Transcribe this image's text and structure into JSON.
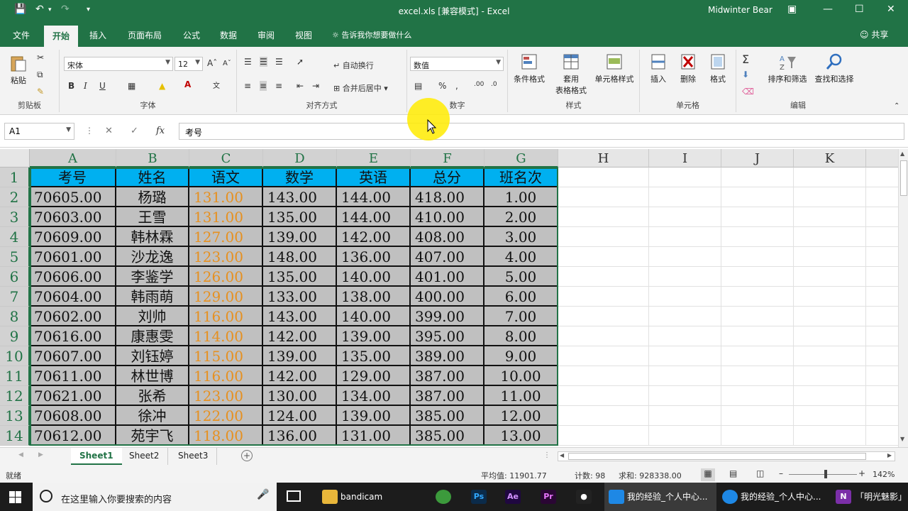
{
  "title_bar": {
    "title": "excel.xls  [兼容模式]  -  Excel",
    "user": "Midwinter Bear"
  },
  "ribbon_tabs": [
    "文件",
    "开始",
    "插入",
    "页面布局",
    "公式",
    "数据",
    "审阅",
    "视图"
  ],
  "tell_me": "告诉我你想要做什么",
  "share": "共享",
  "ribbon": {
    "clipboard": {
      "paste": "粘贴",
      "label": "剪贴板"
    },
    "font": {
      "name": "宋体",
      "size": "12",
      "bold": "B",
      "italic": "I",
      "underline": "U",
      "label": "字体"
    },
    "alignment": {
      "wrap": "自动换行",
      "merge": "合并后居中",
      "label": "对齐方式"
    },
    "number": {
      "format": "数值",
      "percent": "%",
      "label": "数字"
    },
    "styles": {
      "conditional": "条件格式",
      "table_line1": "套用",
      "table_line2": "表格格式",
      "cell_styles": "单元格样式",
      "label": "样式"
    },
    "cells": {
      "insert": "插入",
      "delete": "删除",
      "format": "格式",
      "label": "单元格"
    },
    "editing": {
      "sort": "排序和筛选",
      "find": "查找和选择",
      "label": "编辑"
    }
  },
  "formula_bar": {
    "name_box": "A1",
    "content": "考号"
  },
  "columns": [
    "A",
    "B",
    "C",
    "D",
    "E",
    "F",
    "G",
    "H",
    "I",
    "J",
    "K"
  ],
  "rows": [
    "1",
    "2",
    "3",
    "4",
    "5",
    "6",
    "7",
    "8",
    "9",
    "10",
    "11",
    "12",
    "13",
    "14"
  ],
  "table": {
    "headers": [
      "考号",
      "姓名",
      "语文",
      "数学",
      "英语",
      "总分",
      "班名次"
    ],
    "data": [
      [
        "70605.00",
        "杨璐",
        "131.00",
        "143.00",
        "144.00",
        "418.00",
        "1.00"
      ],
      [
        "70603.00",
        "王雪",
        "131.00",
        "135.00",
        "144.00",
        "410.00",
        "2.00"
      ],
      [
        "70609.00",
        "韩林霖",
        "127.00",
        "139.00",
        "142.00",
        "408.00",
        "3.00"
      ],
      [
        "70601.00",
        "沙龙逸",
        "123.00",
        "148.00",
        "136.00",
        "407.00",
        "4.00"
      ],
      [
        "70606.00",
        "李鉴学",
        "126.00",
        "135.00",
        "140.00",
        "401.00",
        "5.00"
      ],
      [
        "70604.00",
        "韩雨萌",
        "129.00",
        "133.00",
        "138.00",
        "400.00",
        "6.00"
      ],
      [
        "70602.00",
        "刘帅",
        "116.00",
        "143.00",
        "140.00",
        "399.00",
        "7.00"
      ],
      [
        "70616.00",
        "康惠雯",
        "114.00",
        "142.00",
        "139.00",
        "395.00",
        "8.00"
      ],
      [
        "70607.00",
        "刘钰婷",
        "115.00",
        "139.00",
        "135.00",
        "389.00",
        "9.00"
      ],
      [
        "70611.00",
        "林世博",
        "116.00",
        "142.00",
        "129.00",
        "387.00",
        "10.00"
      ],
      [
        "70621.00",
        "张希",
        "123.00",
        "130.00",
        "134.00",
        "387.00",
        "11.00"
      ],
      [
        "70608.00",
        "徐冲",
        "122.00",
        "124.00",
        "139.00",
        "385.00",
        "12.00"
      ],
      [
        "70612.00",
        "苑宇飞",
        "118.00",
        "136.00",
        "131.00",
        "385.00",
        "13.00"
      ]
    ]
  },
  "sheets": [
    "Sheet1",
    "Sheet2",
    "Sheet3"
  ],
  "status": {
    "ready": "就绪",
    "average": "平均值: 11901.77",
    "count": "计数: 98",
    "sum": "求和: 928338.00",
    "zoom": "142%"
  },
  "taskbar": {
    "search_placeholder": "在这里输入你要搜索的内容",
    "folder": "bandicam",
    "ps": "Ps",
    "ae": "Ae",
    "pr": "Pr",
    "app1": "我的经验_个人中心...",
    "app2": "我的经验_个人中心...",
    "app3": "「明光魅影」"
  },
  "colors": {
    "excel_green": "#217346",
    "header_fill": "#00b0f0",
    "body_fill": "#c0c0c0",
    "chinese_score": "#e69020"
  }
}
